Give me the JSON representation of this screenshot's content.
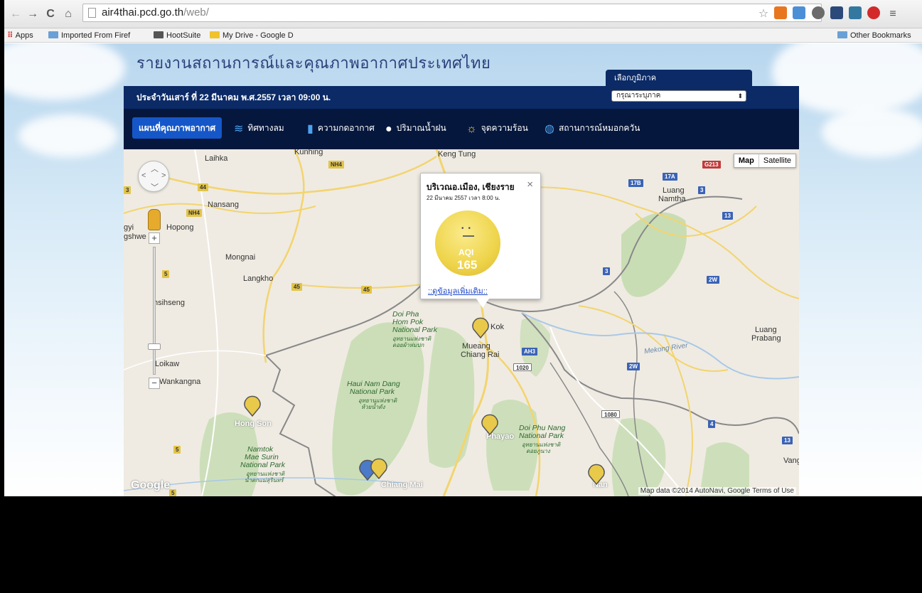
{
  "browser": {
    "url_host": "air4thai.pcd.go.th",
    "url_path": "/web/",
    "bookmarks": [
      "Apps",
      "Imported From Firef",
      "HootSuite",
      "My Drive - Google D"
    ],
    "other_bookmarks": "Other Bookmarks"
  },
  "header": {
    "title": "รายงานสถานการณ์และคุณภาพอากาศประเทศไทย",
    "region_tab": "เลือกภูมิภาค",
    "region_select": "กรุณาระบุภาค",
    "date_text": "ประจำวันเสาร์ ที่ 22 มีนาคม พ.ศ.2557 เวลา 09:00 น."
  },
  "menu": {
    "items": [
      {
        "label": "แผนที่คุณภาพอากาศ"
      },
      {
        "label": "ทิศทางลม"
      },
      {
        "label": "ความกดอากาศ"
      },
      {
        "label": "ปริมาณน้ำฝน"
      },
      {
        "label": "จุดความร้อน"
      },
      {
        "label": "สถานการณ์หมอกควัน"
      }
    ]
  },
  "map": {
    "type_map": "Map",
    "type_satellite": "Satellite",
    "footer": "Map data ©2014 AutoNavi, Google   Terms of Use",
    "logo": "Google",
    "places": {
      "laihka": "Laihka",
      "kunhing": "Kunhing",
      "keng_tung": "Keng Tung",
      "luang_namtha_1": "Luang",
      "luang_namtha_2": "Namtha",
      "nansang": "Nansang",
      "hopong": "Hopong",
      "gyi": "gyi",
      "gshwe": "gshwe",
      "mongnai": "Mongnai",
      "langkho": "Langkho",
      "hsihseng": "hsihseng",
      "loikaw": "Loikaw",
      "wankangna": "Wankangna",
      "kok": "Kok",
      "mueang_1": "Mueang",
      "mueang_2": "Chiang Rai",
      "luang_prabang_1": "Luang",
      "luang_prabang_2": "Prabang",
      "mekong": "Mekong River",
      "hong_son": "Hong Son",
      "phayao": "Phayao",
      "chiang_mai": "Chiang Mai",
      "nan": "Nan",
      "vang": "Vang"
    },
    "parks": {
      "doi_pha_1": "Doi Pha",
      "doi_pha_2": "Hom Pok",
      "doi_pha_3": "National Park",
      "doi_pha_th_1": "อุทยานแห่งชาติ",
      "doi_pha_th_2": "ดอยผ้าห่มปก",
      "haui_1": "Haui Nam Dang",
      "haui_2": "National Park",
      "haui_th_1": "อุทยานแห่งชาติ",
      "haui_th_2": "ห้วยน้ำดัง",
      "namtok_1": "Namtok",
      "namtok_2": "Mae Surin",
      "namtok_3": "National Park",
      "namtok_th_1": "อุทยานแห่งชาติ",
      "namtok_th_2": "น้ำตกแม่สุรินทร์",
      "phu_nang_1": "Doi Phu Nang",
      "phu_nang_2": "National Park",
      "phu_nang_th_1": "อุทยานแห่งชาติ",
      "phu_nang_th_2": "ดอยภูนาง"
    },
    "shields": {
      "nh4_a": "NH4",
      "nh4_b": "NH4",
      "r44": "44",
      "r5": "5",
      "r45a": "45",
      "r45b": "45",
      "r3": "3",
      "r5b": "5",
      "r5c": "5",
      "r17a": "17A",
      "r17b": "17B",
      "r3b": "3",
      "r13": "13",
      "r3c": "3",
      "r2w": "2W",
      "r2w_b": "2W",
      "ah3": "AH3",
      "r1020": "1020",
      "r1080": "1080",
      "r4": "4",
      "r13b": "13",
      "r1148": "G213"
    }
  },
  "popup": {
    "title": "บริเวณอ.เมือง, เชียงราย",
    "date": "22 มีนาคม 2557 เวลา 8:00 น.",
    "aqi_label": "AQI",
    "aqi_value": "165",
    "link": "::ดูข้อมูลเพิ่มเติม::",
    "close": "×"
  },
  "colors": {
    "nav_dark": "#06173d",
    "bar_blue": "#0b2a66",
    "active_blue": "#1557c8",
    "aqi_yellow": "#eed44a"
  }
}
